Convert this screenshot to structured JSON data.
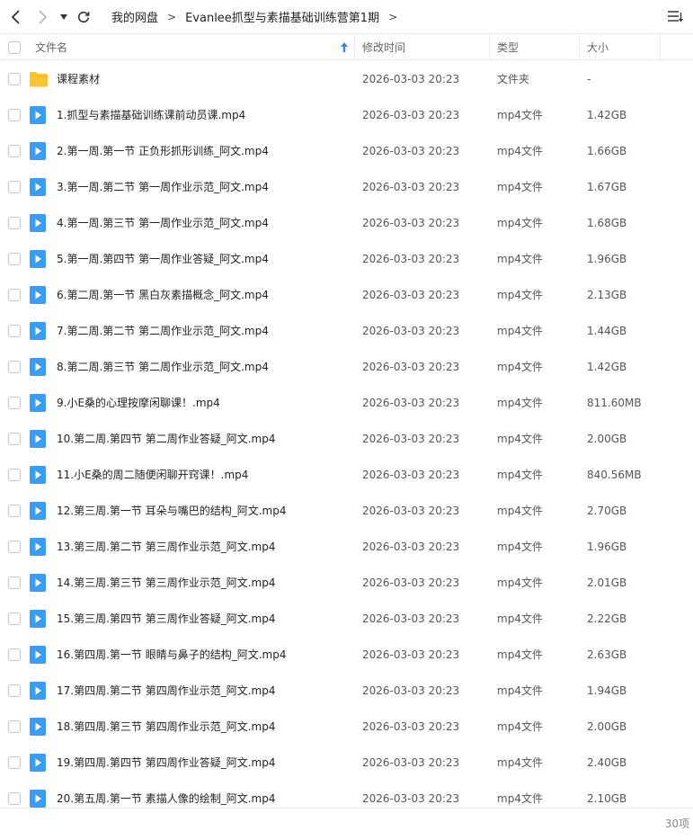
{
  "breadcrumb": [
    "我的网盘",
    "Evanlee抓型与素描基础训练营第1期"
  ],
  "columns": {
    "name": "文件名",
    "modified": "修改时间",
    "type": "类型",
    "size": "大小"
  },
  "icons": {
    "back": "chevron-left-icon",
    "forward": "chevron-right-icon",
    "menu": "dropdown-triangle-icon",
    "refresh": "refresh-icon",
    "view": "list-view-icon",
    "sort": "sort-ascending-icon",
    "folder": "folder-icon",
    "video": "video-file-icon"
  },
  "colors": {
    "folder": "#f9c432",
    "video": "#3b9cf5",
    "sort_arrow": "#3b7ff5"
  },
  "files": [
    {
      "icon": "folder",
      "name": "课程素材",
      "date": "2026-03-03 20:23",
      "type": "文件夹",
      "size": "-"
    },
    {
      "icon": "video",
      "name": "1.抓型与素描基础训练课前动员课.mp4",
      "date": "2026-03-03 20:23",
      "type": "mp4文件",
      "size": "1.42GB"
    },
    {
      "icon": "video",
      "name": "2.第一周.第一节 正负形抓形训练_阿文.mp4",
      "date": "2026-03-03 20:23",
      "type": "mp4文件",
      "size": "1.66GB"
    },
    {
      "icon": "video",
      "name": "3.第一周.第二节 第一周作业示范_阿文.mp4",
      "date": "2026-03-03 20:23",
      "type": "mp4文件",
      "size": "1.67GB"
    },
    {
      "icon": "video",
      "name": "4.第一周.第三节 第一周作业示范_阿文.mp4",
      "date": "2026-03-03 20:23",
      "type": "mp4文件",
      "size": "1.68GB"
    },
    {
      "icon": "video",
      "name": "5.第一周.第四节 第一周作业答疑_阿文.mp4",
      "date": "2026-03-03 20:23",
      "type": "mp4文件",
      "size": "1.96GB"
    },
    {
      "icon": "video",
      "name": "6.第二周.第一节 黑白灰素描概念_阿文.mp4",
      "date": "2026-03-03 20:23",
      "type": "mp4文件",
      "size": "2.13GB"
    },
    {
      "icon": "video",
      "name": "7.第二周.第二节 第二周作业示范_阿文.mp4",
      "date": "2026-03-03 20:23",
      "type": "mp4文件",
      "size": "1.44GB"
    },
    {
      "icon": "video",
      "name": "8.第二周.第三节 第二周作业示范_阿文.mp4",
      "date": "2026-03-03 20:23",
      "type": "mp4文件",
      "size": "1.42GB"
    },
    {
      "icon": "video",
      "name": "9.小E桑的心理按摩闲聊课！.mp4",
      "date": "2026-03-03 20:23",
      "type": "mp4文件",
      "size": "811.60MB"
    },
    {
      "icon": "video",
      "name": "10.第二周.第四节 第二周作业答疑_阿文.mp4",
      "date": "2026-03-03 20:23",
      "type": "mp4文件",
      "size": "2.00GB"
    },
    {
      "icon": "video",
      "name": "11.小E桑的周二随便闲聊开窍课！.mp4",
      "date": "2026-03-03 20:23",
      "type": "mp4文件",
      "size": "840.56MB"
    },
    {
      "icon": "video",
      "name": "12.第三周.第一节 耳朵与嘴巴的结构_阿文.mp4",
      "date": "2026-03-03 20:23",
      "type": "mp4文件",
      "size": "2.70GB"
    },
    {
      "icon": "video",
      "name": "13.第三周.第二节 第三周作业示范_阿文.mp4",
      "date": "2026-03-03 20:23",
      "type": "mp4文件",
      "size": "1.96GB"
    },
    {
      "icon": "video",
      "name": "14.第三周.第三节 第三周作业示范_阿文.mp4",
      "date": "2026-03-03 20:23",
      "type": "mp4文件",
      "size": "2.01GB"
    },
    {
      "icon": "video",
      "name": "15.第三周.第四节 第三周作业答疑_阿文.mp4",
      "date": "2026-03-03 20:23",
      "type": "mp4文件",
      "size": "2.22GB"
    },
    {
      "icon": "video",
      "name": "16.第四周.第一节 眼睛与鼻子的结构_阿文.mp4",
      "date": "2026-03-03 20:23",
      "type": "mp4文件",
      "size": "2.63GB"
    },
    {
      "icon": "video",
      "name": "17.第四周.第二节 第四周作业示范_阿文.mp4",
      "date": "2026-03-03 20:23",
      "type": "mp4文件",
      "size": "1.94GB"
    },
    {
      "icon": "video",
      "name": "18.第四周.第三节 第四周作业示范_阿文.mp4",
      "date": "2026-03-03 20:23",
      "type": "mp4文件",
      "size": "2.00GB"
    },
    {
      "icon": "video",
      "name": "19.第四周.第四节 第四周作业答疑_阿文.mp4",
      "date": "2026-03-03 20:23",
      "type": "mp4文件",
      "size": "2.40GB"
    },
    {
      "icon": "video",
      "name": "20.第五周.第一节 素描人像的绘制_阿文.mp4",
      "date": "2026-03-03 20:23",
      "type": "mp4文件",
      "size": "2.10GB"
    }
  ],
  "footer": {
    "item_count": "30项"
  }
}
